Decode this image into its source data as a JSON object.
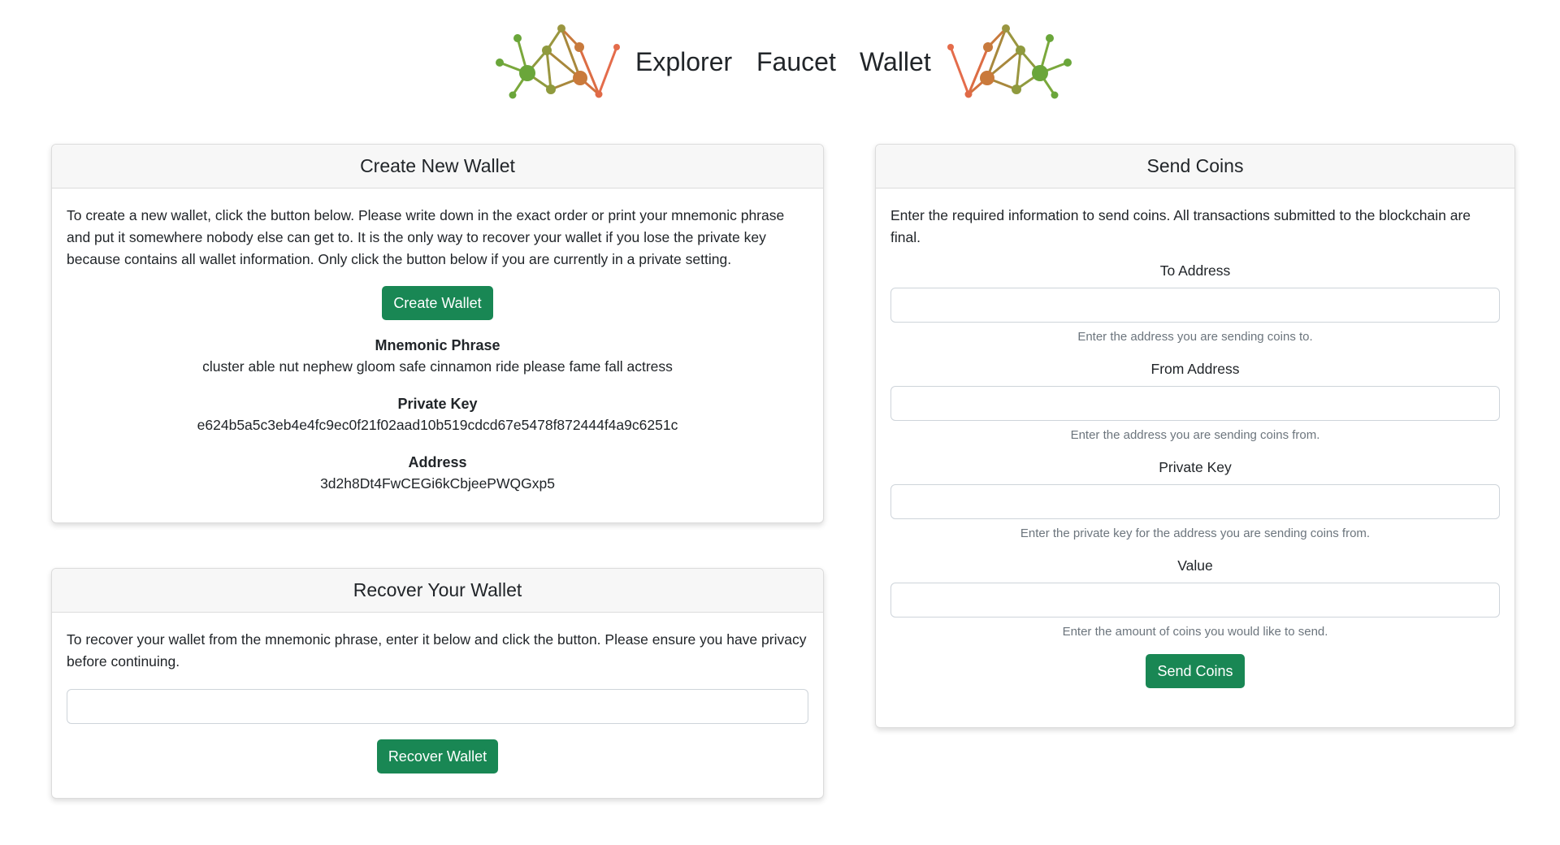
{
  "nav": {
    "links": [
      "Explorer",
      "Faucet",
      "Wallet"
    ]
  },
  "logo": {
    "icon": "network-graph-logo",
    "colors": {
      "green": "#6aa63a",
      "olive": "#9a9640",
      "orange": "#c97a3b",
      "red": "#e46c4b"
    }
  },
  "theme": {
    "button_color": "#198754"
  },
  "create_wallet": {
    "title": "Create New Wallet",
    "intro": "To create a new wallet, click the button below. Please write down in the exact order or print your mnemonic phrase and put it somewhere nobody else can get to. It is the only way to recover your wallet if you lose the private key because contains all wallet information. Only click the button below if you are currently in a private setting.",
    "button": "Create Wallet",
    "mnemonic_label": "Mnemonic Phrase",
    "mnemonic_value": "cluster able nut nephew gloom safe cinnamon ride please fame fall actress",
    "private_key_label": "Private Key",
    "private_key_value": "e624b5a5c3eb4e4fc9ec0f21f02aad10b519cdcd67e5478f872444f4a9c6251c",
    "address_label": "Address",
    "address_value": "3d2h8Dt4FwCEGi6kCbjeePWQGxp5"
  },
  "recover_wallet": {
    "title": "Recover Your Wallet",
    "intro": "To recover your wallet from the mnemonic phrase, enter it below and click the button. Please ensure you have privacy before continuing.",
    "input_value": "",
    "button": "Recover Wallet"
  },
  "send_coins": {
    "title": "Send Coins",
    "intro": "Enter the required information to send coins. All transactions submitted to the blockchain are final.",
    "fields": [
      {
        "label": "To Address",
        "value": "",
        "help": "Enter the address you are sending coins to."
      },
      {
        "label": "From Address",
        "value": "",
        "help": "Enter the address you are sending coins from."
      },
      {
        "label": "Private Key",
        "value": "",
        "help": "Enter the private key for the address you are sending coins from."
      },
      {
        "label": "Value",
        "value": "",
        "help": "Enter the amount of coins you would like to send."
      }
    ],
    "button": "Send Coins"
  }
}
